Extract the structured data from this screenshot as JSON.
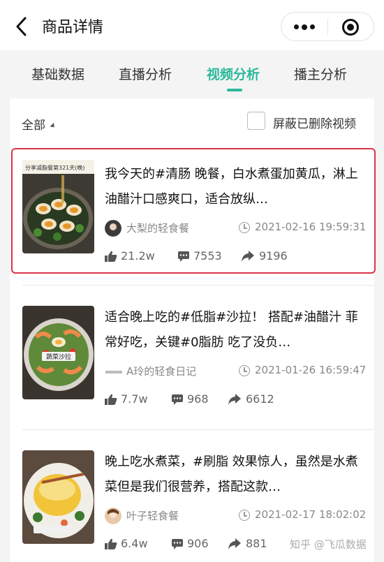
{
  "header": {
    "title": "商品详情",
    "back_icon": "back-arrow-icon",
    "more_icon": "more-dots-icon",
    "close_icon": "target-circle-icon"
  },
  "tabs": [
    {
      "label": "基础数据",
      "active": false
    },
    {
      "label": "直播分析",
      "active": false
    },
    {
      "label": "视频分析",
      "active": true
    },
    {
      "label": "播主分析",
      "active": false
    }
  ],
  "colors": {
    "accent": "#2bb89a",
    "highlight_border": "#d6364b"
  },
  "filter": {
    "label": "全部",
    "hide_deleted_label": "屏蔽已删除视频",
    "hide_deleted_checked": false
  },
  "videos": [
    {
      "description": "我今天的#清肠 晚餐，白水煮蛋加黄瓜，淋上油醋汁口感爽口，适合放纵…",
      "author": "大梨的轻食餐",
      "time": "2021-02-16 19:59:31",
      "likes": "21.2w",
      "comments": "7553",
      "shares": "9196",
      "thumb_caption": "分享减脂餐第321天(晚)",
      "selected": true
    },
    {
      "description": "适合晚上吃的#低脂#沙拉！ 搭配#油醋汁 菲常好吃，关键#0脂肪 吃了没负…",
      "author": "A玲的轻食日记",
      "time": "2021-01-26 16:59:47",
      "likes": "7.7w",
      "comments": "968",
      "shares": "6612",
      "thumb_caption": "蔬菜沙拉",
      "selected": false
    },
    {
      "description": "晚上吃水煮菜，#刷脂 效果惊人，虽然是水煮菜但是我们很营养，搭配这款…",
      "author": "叶子轻食餐",
      "time": "2021-02-17 18:02:02",
      "likes": "6.4w",
      "comments": "906",
      "shares": "881",
      "thumb_caption": "",
      "selected": false
    }
  ],
  "watermark": "知乎 @飞瓜数据"
}
